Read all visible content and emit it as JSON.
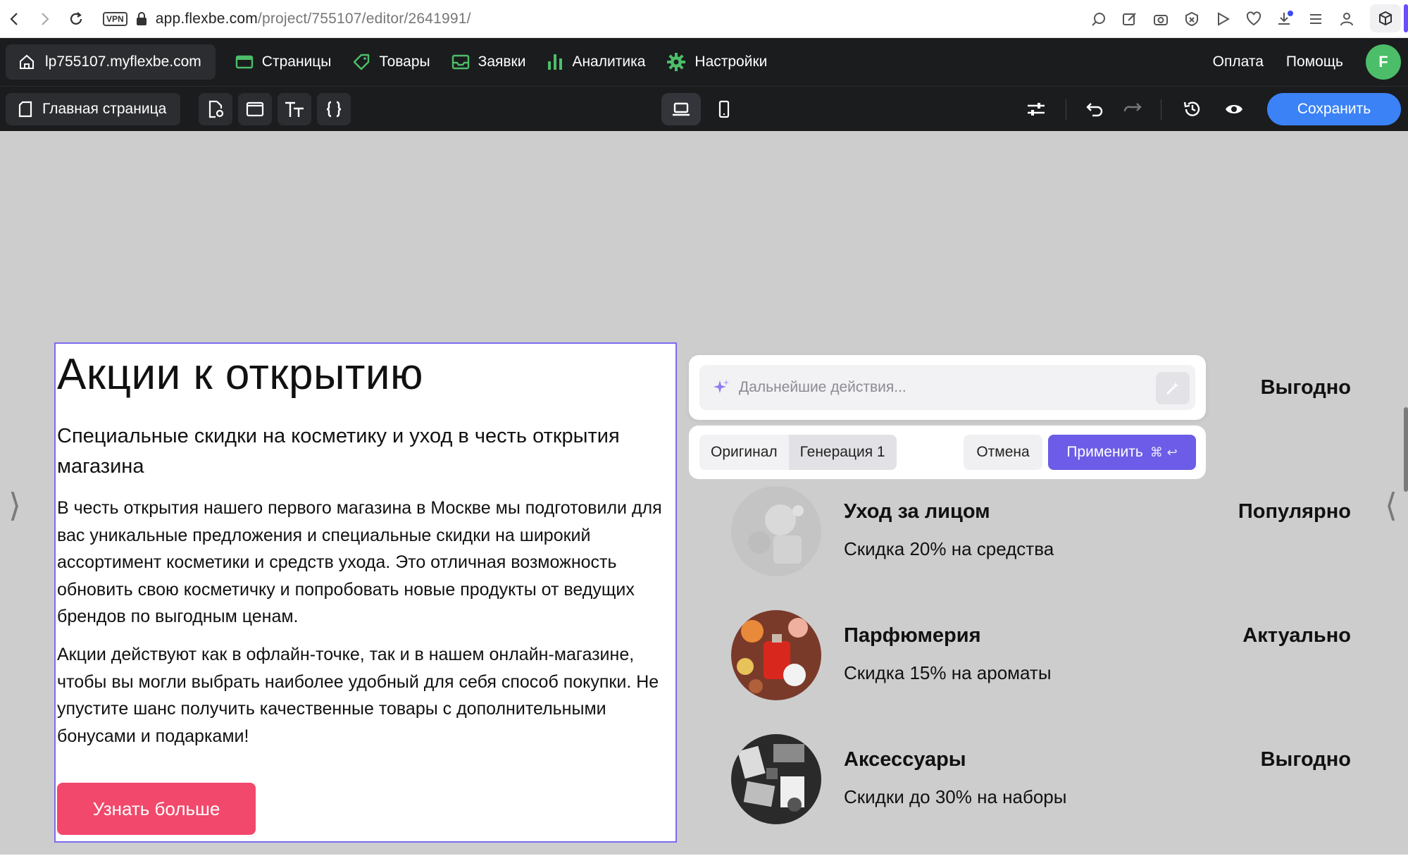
{
  "browser": {
    "url_host": "app.flexbe.com",
    "url_path": "/project/755107/editor/2641991/",
    "vpn_label": "VPN"
  },
  "editor": {
    "site_domain": "lp755107.myflexbe.com",
    "nav": [
      {
        "label": "Страницы",
        "icon": "pages-icon"
      },
      {
        "label": "Товары",
        "icon": "tag-icon"
      },
      {
        "label": "Заявки",
        "icon": "inbox-icon"
      },
      {
        "label": "Аналитика",
        "icon": "chart-icon"
      },
      {
        "label": "Настройки",
        "icon": "gear-icon"
      }
    ],
    "payment_link": "Оплата",
    "help_link": "Помощь",
    "avatar_letter": "F",
    "current_page": "Главная страница",
    "save_label": "Сохранить",
    "colors": {
      "accent": "#3b82f6",
      "selection": "#7c6cf0",
      "avatar": "#4cbe69",
      "cta": "#f2486b",
      "apply": "#6c5ce7"
    }
  },
  "content": {
    "title": "Акции к открытию",
    "subtitle": "Специальные скидки на косметику и уход в честь открытия магазина",
    "paragraph1": "В честь открытия нашего первого магазина в Москве мы подготовили для вас уникальные предложения и специальные скидки на широкий ассортимент косметики и средств ухода. Это отличная возможность обновить свою косметичку и попробовать новые продукты от ведущих брендов по выгодным ценам.",
    "paragraph2": "Акции действуют как в офлайн-точке, так и в нашем онлайн-магазине, чтобы вы могли выбрать наиболее удобный для себя способ покупки. Не упустите шанс получить качественные товары с дополнительными бонусами и подарками!",
    "cta_label": "Узнать больше",
    "first_item_badge": "Выгодно",
    "items": [
      {
        "title": "Уход за лицом",
        "desc": "Скидка 20% на средства",
        "badge": "Популярно"
      },
      {
        "title": "Парфюмерия",
        "desc": "Скидка 15% на ароматы",
        "badge": "Актуально"
      },
      {
        "title": "Аксессуары",
        "desc": "Скидки до 30% на наборы",
        "badge": "Выгодно"
      }
    ]
  },
  "ai": {
    "placeholder": "Дальнейшие действия...",
    "tab_original": "Оригинал",
    "tab_generation": "Генерация 1",
    "cancel_label": "Отмена",
    "apply_label": "Применить",
    "apply_shortcut": "⌘ ↩"
  }
}
